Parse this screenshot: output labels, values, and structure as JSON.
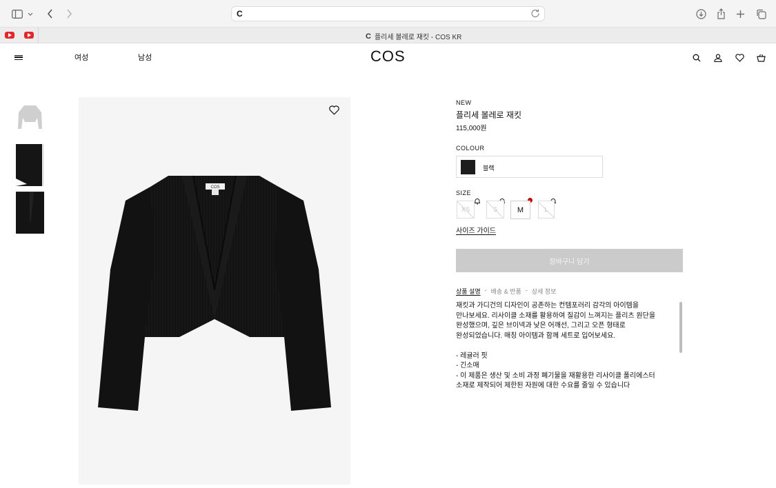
{
  "browser": {
    "address_favicon": "C",
    "tab_title": "플리세 볼레로 재킷 - COS KR",
    "tab_favicon": "C"
  },
  "header": {
    "nav": [
      "여성",
      "남성"
    ],
    "logo": "COS"
  },
  "product": {
    "badge": "NEW",
    "name": "플리세 볼레로 재킷",
    "price": "115,000원",
    "colour_label": "COLOUR",
    "colour_name": "블랙",
    "size_label": "SIZE",
    "sizes": [
      {
        "label": "XS",
        "available": false,
        "notify": true
      },
      {
        "label": "S",
        "available": false,
        "notify": true
      },
      {
        "label": "M",
        "available": true,
        "notify": false,
        "low_stock": true
      },
      {
        "label": "L",
        "available": false,
        "notify": true
      }
    ],
    "size_guide": "사이즈 가이드",
    "add_to_cart": "장바구니 담기",
    "tabs": [
      "상품 설명",
      "배송 & 반품",
      "상세 정보"
    ],
    "tab_separator": "-",
    "description": "재킷과 가디건의 디자인이 공존하는 컨템포러리 감각의 아이템을\n만나보세요. 리사이클 소재를 활용하여 질감이 느껴지는 플리츠 원단을\n완성했으며, 깊은 브이넥과 낮은 어깨선, 그리고 오픈 형태로\n완성되었습니다. 매칭 아이템과 함께 세트로 입어보세요.\n\n- 레귤러 핏\n- 긴소매\n- 이 제품은 생산 및 소비 과정 폐기물을 재활용한 리사이클 폴리에스터\n소재로 제작되어 제한된 자원에 대한 수요를 줄일 수 있습니다",
    "care_label": "COS"
  },
  "colors": {
    "accent_dot": "#cc0000",
    "garment": "#121212",
    "cart_disabled": "#cbcbcb"
  }
}
